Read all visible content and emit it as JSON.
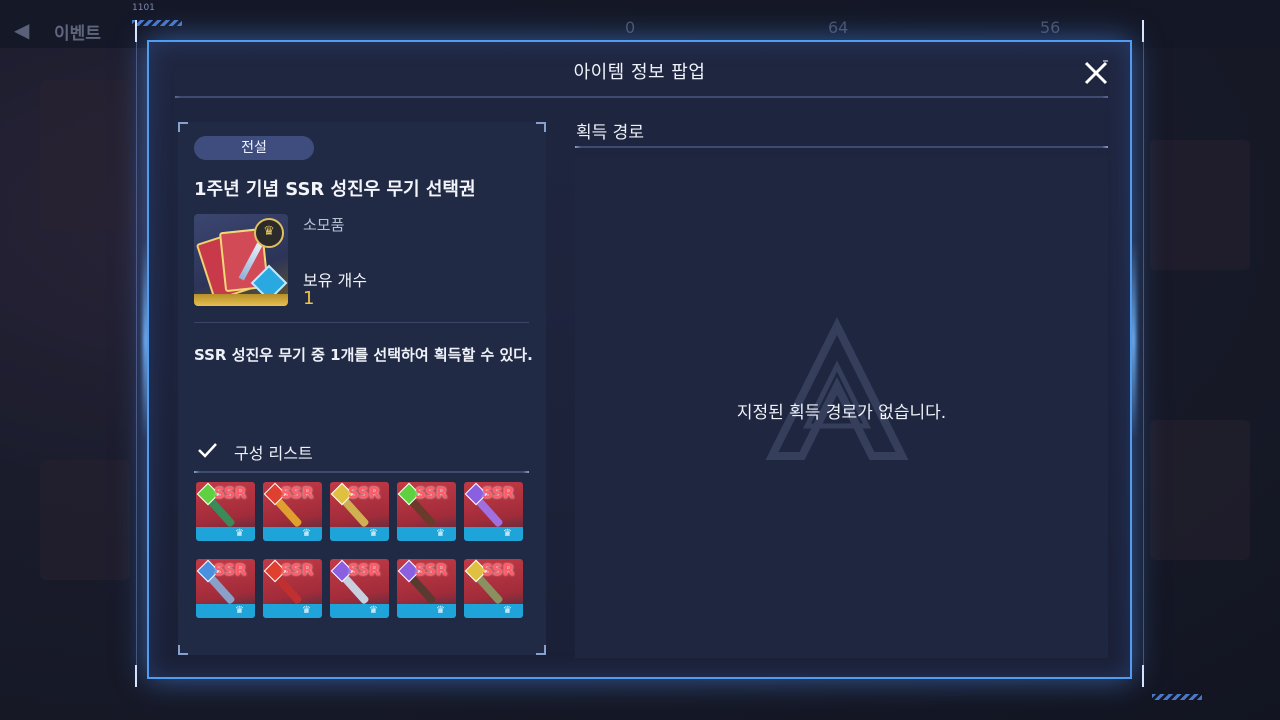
{
  "background": {
    "title": "이벤트",
    "hud_code": "1101",
    "resources": [
      "0",
      "64",
      "56"
    ]
  },
  "popup": {
    "title": "아이템 정보 팝업"
  },
  "item": {
    "grade": "전설",
    "name": "1주년 기념 SSR 성진우 무기 선택권",
    "type": "소모품",
    "own_label": "보유 개수",
    "own_count": "1",
    "description": "SSR 성진우 무기 중 1개를 선택하여 획득할 수 있다."
  },
  "composition": {
    "title": "구성 리스트",
    "weapons": [
      {
        "rarity": "SSR",
        "element_color": "#5fd040",
        "blade_color": "#3a8a5a"
      },
      {
        "rarity": "SSR",
        "element_color": "#e04030",
        "blade_color": "#e0a030"
      },
      {
        "rarity": "SSR",
        "element_color": "#e0c040",
        "blade_color": "#d0b050"
      },
      {
        "rarity": "SSR",
        "element_color": "#5fd040",
        "blade_color": "#6a3a2a"
      },
      {
        "rarity": "SSR",
        "element_color": "#8a60e0",
        "blade_color": "#a070e0"
      },
      {
        "rarity": "SSR",
        "element_color": "#4a90e0",
        "blade_color": "#8aa0c8"
      },
      {
        "rarity": "SSR",
        "element_color": "#e04030",
        "blade_color": "#c03030"
      },
      {
        "rarity": "SSR",
        "element_color": "#8a60e0",
        "blade_color": "#c8d0e0"
      },
      {
        "rarity": "SSR",
        "element_color": "#8a60e0",
        "blade_color": "#5a3a30"
      },
      {
        "rarity": "SSR",
        "element_color": "#e0c040",
        "blade_color": "#8a9060"
      }
    ]
  },
  "acquisition": {
    "title": "획득 경로",
    "empty_message": "지정된 획득 경로가 없습니다."
  },
  "colors": {
    "popup_border": "#4f9cf0",
    "grade_badge": "#3e4d7e",
    "own_count": "#f0c24a"
  }
}
